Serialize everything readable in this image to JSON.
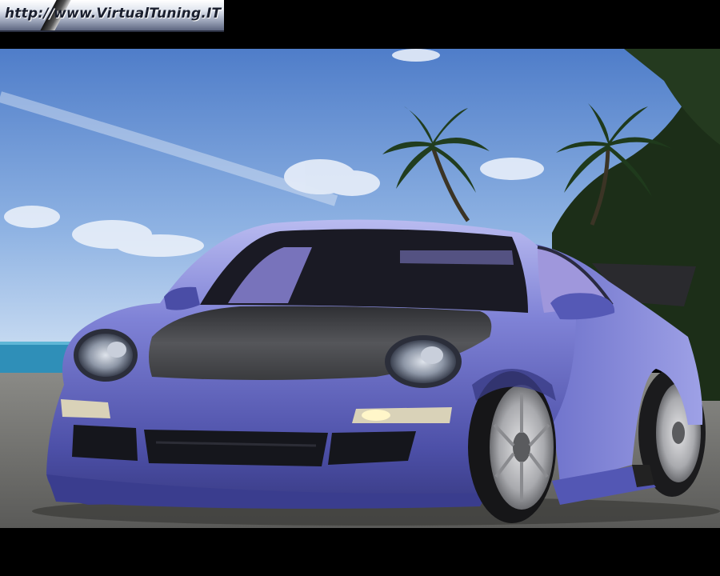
{
  "watermark": {
    "text": "http://www.VirtualTuning.IT"
  },
  "scene": {
    "colors": {
      "sky_top": "#4f7dc9",
      "sky_bottom": "#c9dcf2",
      "sea": "#2f8fb8",
      "ground": "#6f6f6c",
      "car_body": "#6f72c8",
      "car_shadow": "#3d3f8c",
      "hood_carbon": "#3e3f42",
      "palm": "#1f3a1c"
    }
  }
}
